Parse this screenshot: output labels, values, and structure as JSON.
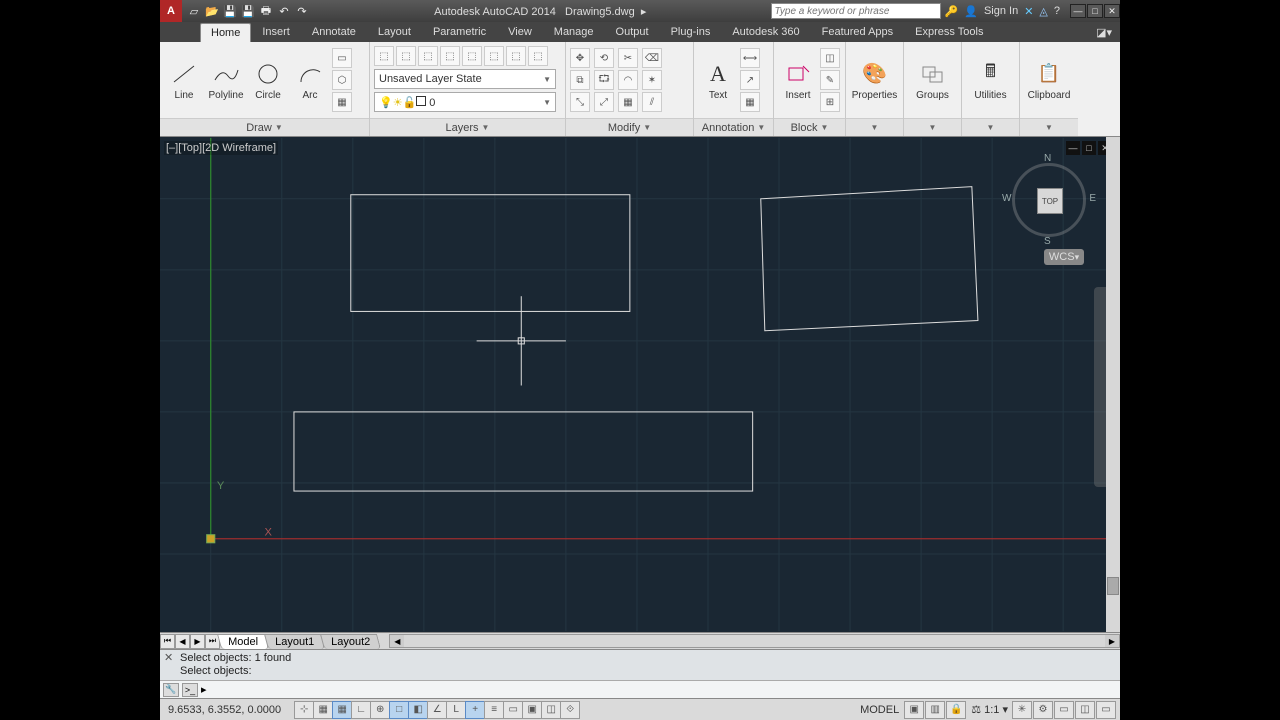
{
  "title": {
    "app": "Autodesk AutoCAD 2014",
    "file": "Drawing5.dwg"
  },
  "search_placeholder": "Type a keyword or phrase",
  "signin": "Sign In",
  "ribbon_tabs": [
    "Home",
    "Insert",
    "Annotate",
    "Layout",
    "Parametric",
    "View",
    "Manage",
    "Output",
    "Plug-ins",
    "Autodesk 360",
    "Featured Apps",
    "Express Tools"
  ],
  "active_tab": "Home",
  "panels": {
    "draw": {
      "title": "Draw",
      "tools": [
        "Line",
        "Polyline",
        "Circle",
        "Arc"
      ]
    },
    "layers": {
      "title": "Layers",
      "state": "Unsaved Layer State",
      "current": "0"
    },
    "modify": {
      "title": "Modify"
    },
    "annotation": {
      "title": "Annotation",
      "text": "Text"
    },
    "block": {
      "title": "Block",
      "insert": "Insert"
    },
    "properties": {
      "title": "Properties"
    },
    "groups": {
      "title": "Groups"
    },
    "utilities": {
      "title": "Utilities"
    },
    "clipboard": {
      "title": "Clipboard"
    }
  },
  "viewport": {
    "label": "[–][Top][2D Wireframe]"
  },
  "viewcube": {
    "face": "TOP",
    "n": "N",
    "s": "S",
    "e": "E",
    "w": "W",
    "wcs": "WCS"
  },
  "sheets": [
    "Model",
    "Layout1",
    "Layout2"
  ],
  "command": {
    "hist1": "Select objects: 1 found",
    "hist2": "Select objects:",
    "prompt": ">_"
  },
  "status": {
    "coords": "9.6533, 6.3552, 0.0000",
    "model": "MODEL",
    "scale": "1:1"
  }
}
